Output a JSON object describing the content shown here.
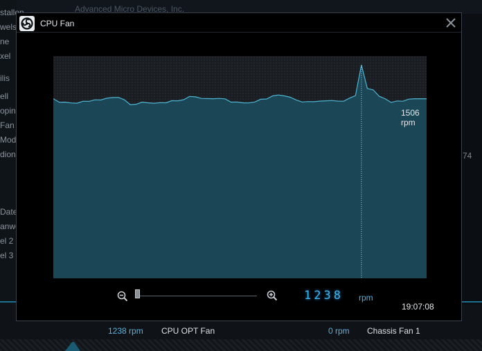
{
  "background": {
    "vendor_text": "Advanced Micro Devices, Inc.",
    "sidebar_items": [
      "stallen",
      "wels",
      "ne",
      "xel",
      "ilis",
      "ell",
      "oping",
      "Fan",
      "Mod",
      "dion",
      "Date",
      "anwe",
      "el 2",
      "el 3"
    ],
    "right_text": "74",
    "fan_row": [
      {
        "value": "1238 rpm",
        "name": "CPU OPT Fan"
      },
      {
        "value": "0 rpm",
        "name": "Chassis Fan 1"
      }
    ]
  },
  "dialog": {
    "title": "CPU Fan",
    "readout_value": "1506  rpm",
    "readout_time": "19:07:08",
    "digital_value": "1238",
    "digital_unit": "rpm",
    "accent_color": "#3fb3f0",
    "fill_color": "#1b4d5f",
    "line_color": "#4fb6d4"
  },
  "chart_data": {
    "type": "area",
    "series_unit": "rpm",
    "values": [
      1268,
      1243,
      1244,
      1238,
      1236,
      1250,
      1249,
      1260,
      1259,
      1271,
      1276,
      1277,
      1260,
      1226,
      1229,
      1244,
      1239,
      1236,
      1240,
      1239,
      1254,
      1253,
      1261,
      1284,
      1281,
      1270,
      1269,
      1268,
      1270,
      1267,
      1244,
      1245,
      1239,
      1238,
      1245,
      1264,
      1266,
      1288,
      1294,
      1288,
      1278,
      1259,
      1245,
      1248,
      1247,
      1251,
      1253,
      1255,
      1251,
      1250,
      1272,
      1290,
      1506,
      1340,
      1330,
      1285,
      1268,
      1242,
      1252,
      1250,
      1265,
      1268,
      1268,
      1268
    ],
    "highlight_index": 52,
    "highlight_value": 1506,
    "highlight_time": "19:07:08",
    "ylim": [
      0,
      1520
    ]
  }
}
